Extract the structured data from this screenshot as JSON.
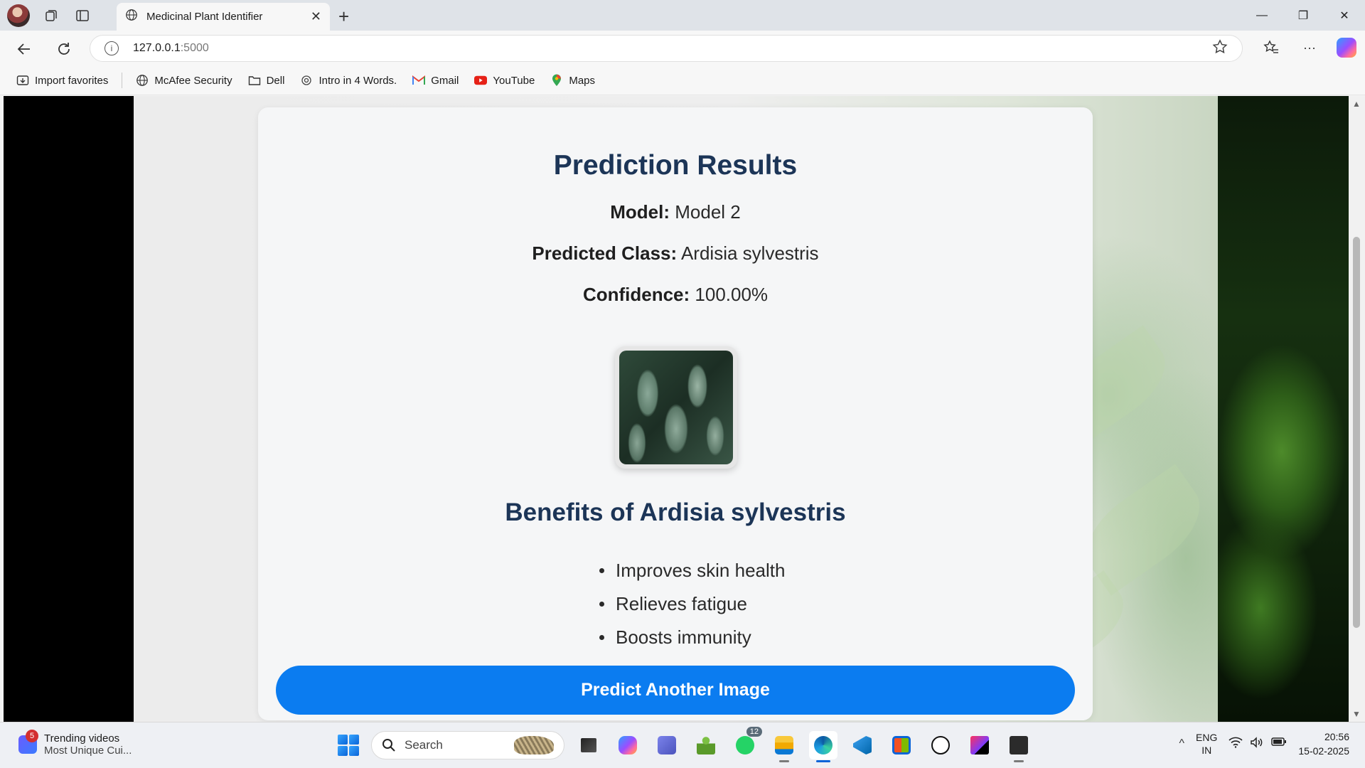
{
  "browser": {
    "tab_title": "Medicinal Plant Identifier",
    "url_host": "127.0.0.1",
    "url_port": ":5000",
    "favorites": [
      {
        "label": "Import favorites",
        "icon": "import-icon"
      },
      {
        "label": "McAfee Security",
        "icon": "globe-icon"
      },
      {
        "label": "Dell",
        "icon": "folder-icon"
      },
      {
        "label": "Intro in 4 Words.",
        "icon": "openai-icon"
      },
      {
        "label": "Gmail",
        "icon": "gmail-icon"
      },
      {
        "label": "YouTube",
        "icon": "youtube-icon"
      },
      {
        "label": "Maps",
        "icon": "maps-icon"
      }
    ]
  },
  "page": {
    "heading": "Prediction Results",
    "model_label": "Model:",
    "model_value": "Model 2",
    "class_label": "Predicted Class:",
    "class_value": "Ardisia sylvestris",
    "confidence_label": "Confidence:",
    "confidence_value": "100.00%",
    "benefits_heading": "Benefits of Ardisia sylvestris",
    "benefits": [
      "Improves skin health",
      "Relieves fatigue",
      "Boosts immunity"
    ],
    "button_label": "Predict Another Image",
    "colors": {
      "heading": "#1c3557",
      "button": "#0b7cf0"
    }
  },
  "taskbar": {
    "news_badge": "5",
    "news_title": "Trending videos",
    "news_subtitle": "Most Unique Cui...",
    "search_label": "Search",
    "whatsapp_badge": "12",
    "lang_top": "ENG",
    "lang_bottom": "IN",
    "time": "20:56",
    "date": "15-02-2025"
  }
}
